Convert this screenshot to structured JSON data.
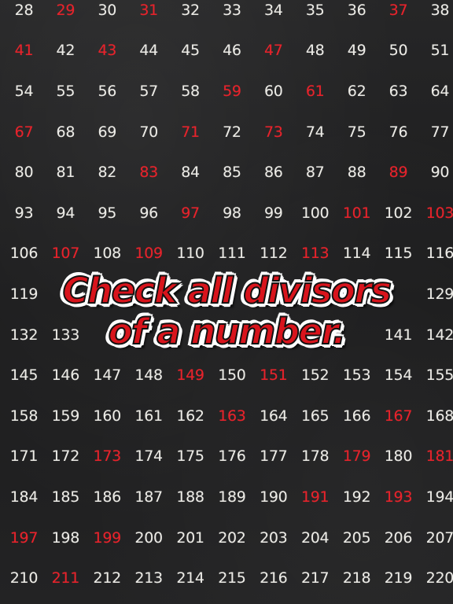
{
  "headline": {
    "line1": "Check all divisors",
    "line2": "of a number."
  },
  "colors": {
    "background": "#1e1e1f",
    "number_default": "#ecebe6",
    "number_prime": "#e8222b",
    "headline_fill": "#d8141c",
    "headline_outline": "#ffffff"
  },
  "grid": {
    "rows": [
      [
        28,
        29,
        30,
        31,
        32,
        33,
        34,
        35,
        36,
        37,
        38
      ],
      [
        41,
        42,
        43,
        44,
        45,
        46,
        47,
        48,
        49,
        50,
        51
      ],
      [
        54,
        55,
        56,
        57,
        58,
        59,
        60,
        61,
        62,
        63,
        64
      ],
      [
        67,
        68,
        69,
        70,
        71,
        72,
        73,
        74,
        75,
        76,
        77
      ],
      [
        80,
        81,
        82,
        83,
        84,
        85,
        86,
        87,
        88,
        89,
        90
      ],
      [
        93,
        94,
        95,
        96,
        97,
        98,
        99,
        100,
        101,
        102,
        103
      ],
      [
        106,
        107,
        108,
        109,
        110,
        111,
        112,
        113,
        114,
        115,
        116
      ],
      [
        119,
        null,
        null,
        null,
        null,
        null,
        null,
        null,
        null,
        null,
        129
      ],
      [
        132,
        133,
        null,
        null,
        null,
        null,
        null,
        null,
        null,
        141,
        142
      ],
      [
        145,
        146,
        147,
        148,
        149,
        150,
        151,
        152,
        153,
        154,
        155
      ],
      [
        158,
        159,
        160,
        161,
        162,
        163,
        164,
        165,
        166,
        167,
        168
      ],
      [
        171,
        172,
        173,
        174,
        175,
        176,
        177,
        178,
        179,
        180,
        181
      ],
      [
        184,
        185,
        186,
        187,
        188,
        189,
        190,
        191,
        192,
        193,
        194
      ],
      [
        197,
        198,
        199,
        200,
        201,
        202,
        203,
        204,
        205,
        206,
        207
      ],
      [
        210,
        211,
        212,
        213,
        214,
        215,
        216,
        217,
        218,
        219,
        220
      ]
    ],
    "primes_highlighted": [
      29,
      31,
      37,
      41,
      43,
      47,
      59,
      61,
      67,
      71,
      73,
      83,
      89,
      97,
      101,
      103,
      107,
      109,
      113,
      149,
      151,
      163,
      167,
      173,
      179,
      181,
      191,
      193,
      197,
      199,
      211
    ]
  }
}
